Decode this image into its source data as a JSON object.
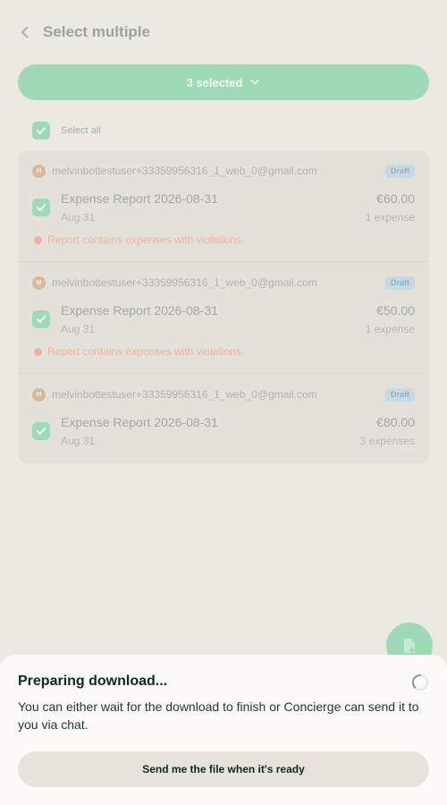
{
  "header": {
    "title": "Select multiple",
    "back_icon": "chevron-left-icon"
  },
  "selection": {
    "label": "3 selected",
    "icon": "chevron-down-icon"
  },
  "select_all": {
    "label": "Select all",
    "checked": true
  },
  "reports": [
    {
      "avatar_initial": "M",
      "email": "melvinbottestuser+33359956316_1_web_0@gmail.com",
      "badge": "Draft",
      "title": "Expense Report 2026-08-31",
      "amount": "€60.00",
      "date": "Aug 31",
      "count": "1 expense",
      "violation": "Report contains expenses with violations.",
      "checked": true
    },
    {
      "avatar_initial": "M",
      "email": "melvinbottestuser+33359956316_1_web_0@gmail.com",
      "badge": "Draft",
      "title": "Expense Report 2026-08-31",
      "amount": "€50.00",
      "date": "Aug 31",
      "count": "1 expense",
      "violation": "Report contains expenses with violations.",
      "checked": true
    },
    {
      "avatar_initial": "M",
      "email": "melvinbottestuser+33359956316_1_web_0@gmail.com",
      "badge": "Draft",
      "title": "Expense Report 2026-08-31",
      "amount": "€80.00",
      "date": "Aug 31",
      "count": "3 expenses",
      "checked": true
    }
  ],
  "fab": {
    "icon": "new-report-icon"
  },
  "sheet": {
    "title": "Preparing download...",
    "description": "You can either wait for the download to finish or Concierge can send it to you via chat.",
    "button_label": "Send me the file when it's ready",
    "spinner_icon": "loading-spinner-icon"
  },
  "colors": {
    "background": "#ECE9E3",
    "accent": "#9FDAB8",
    "violation": "#F0B19A",
    "badge_bg": "#C9D9E3",
    "sheet_bg": "#FBFAF8",
    "text_dark": "#0B2A1E"
  }
}
